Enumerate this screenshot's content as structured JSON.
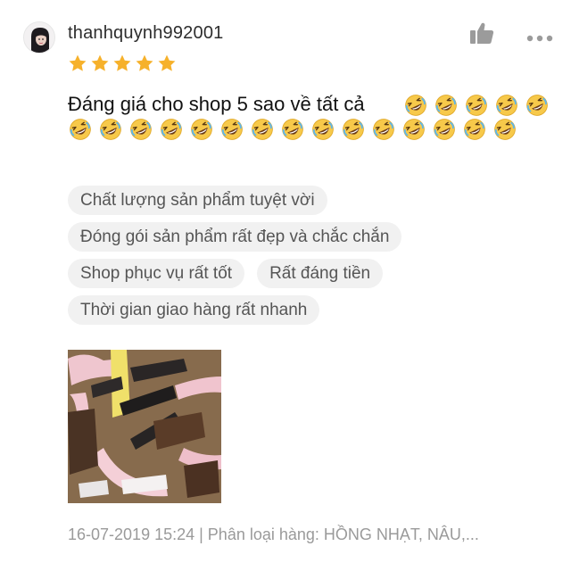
{
  "review": {
    "username": "thanhquynh992001",
    "rating": 5,
    "rating_max": 5,
    "text": "Đáng giá cho shop 5 sao về tất cả",
    "emoji_count": 20,
    "emoji_name": "rolling-on-floor-laughing-emoji",
    "tags": [
      "Chất lượng sản phẩm tuyệt vời",
      "Đóng gói sản phẩm rất đẹp và chắc chắn",
      "Shop phục vụ rất tốt",
      "Rất đáng tiền",
      "Thời gian giao hàng rất nhanh"
    ],
    "footer": "16-07-2019 15:24 | Phân loại hàng: HỒNG NHẠT, NÂU,..."
  },
  "icons": {
    "like": "thumbs-up-icon",
    "more": "more-options-icon",
    "star": "star-icon"
  },
  "colors": {
    "star": "#f6b12b",
    "text": "#111111",
    "muted": "#9a9a9a",
    "tag_bg": "#f1f1f1",
    "icon": "#9b9b9b"
  }
}
